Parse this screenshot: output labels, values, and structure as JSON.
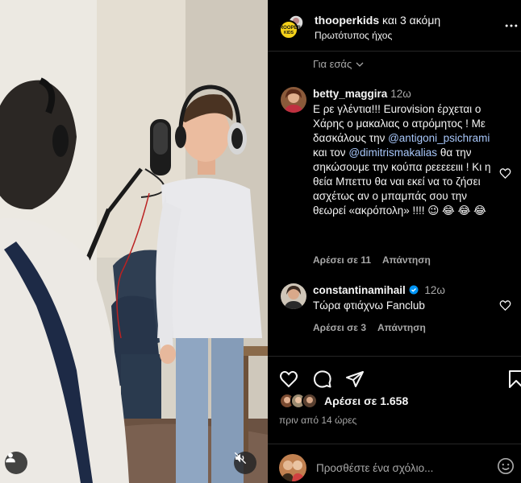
{
  "header": {
    "username": "thooperkids",
    "and_more": "και 3 ακόμη",
    "audio": "Πρωτότυπος ήχος",
    "more_icon": "more-horizontal-icon"
  },
  "filter": {
    "label": "Για εσάς"
  },
  "comments": [
    {
      "user": "betty_maggira",
      "time": "12ω",
      "text_part1": "Ε ρε γλέντια!!! Eurovision έρχεται ο Χάρης ο μακαλιας ο ατρόμητος ! Με δασκάλους την",
      "mention1": "@antigoni_psichrami",
      "text_part2": "και τον",
      "mention2": "@dimitrismakalias",
      "text_part3": "θα την σηκώσουμε την κούπα ρεεεεειιι ! Κι η θεία Μπεττυ θα ναι εκεί να το ζήσει ασχέτως αν ο μπαμπάς σου την θεωρεί «ακρόπολη» !!!! 😉 😂 😂 😂",
      "likes": "Αρέσει σε 11",
      "reply": "Απάντηση"
    },
    {
      "user": "constantinamihail",
      "time": "12ω",
      "text": "Τώρα φτιάχνω Fanclub",
      "likes": "Αρέσει σε 3",
      "reply": "Απάντηση"
    }
  ],
  "post": {
    "likes": "Αρέσει σε 1.658",
    "time_ago": "πριν από 14 ώρες"
  },
  "add_comment": {
    "placeholder": "Προσθέστε ένα σχόλιο..."
  },
  "colors": {
    "accent": "#a8c7fa",
    "muted": "#a8a8a8",
    "verified": "#0095f6",
    "background": "#000000"
  }
}
